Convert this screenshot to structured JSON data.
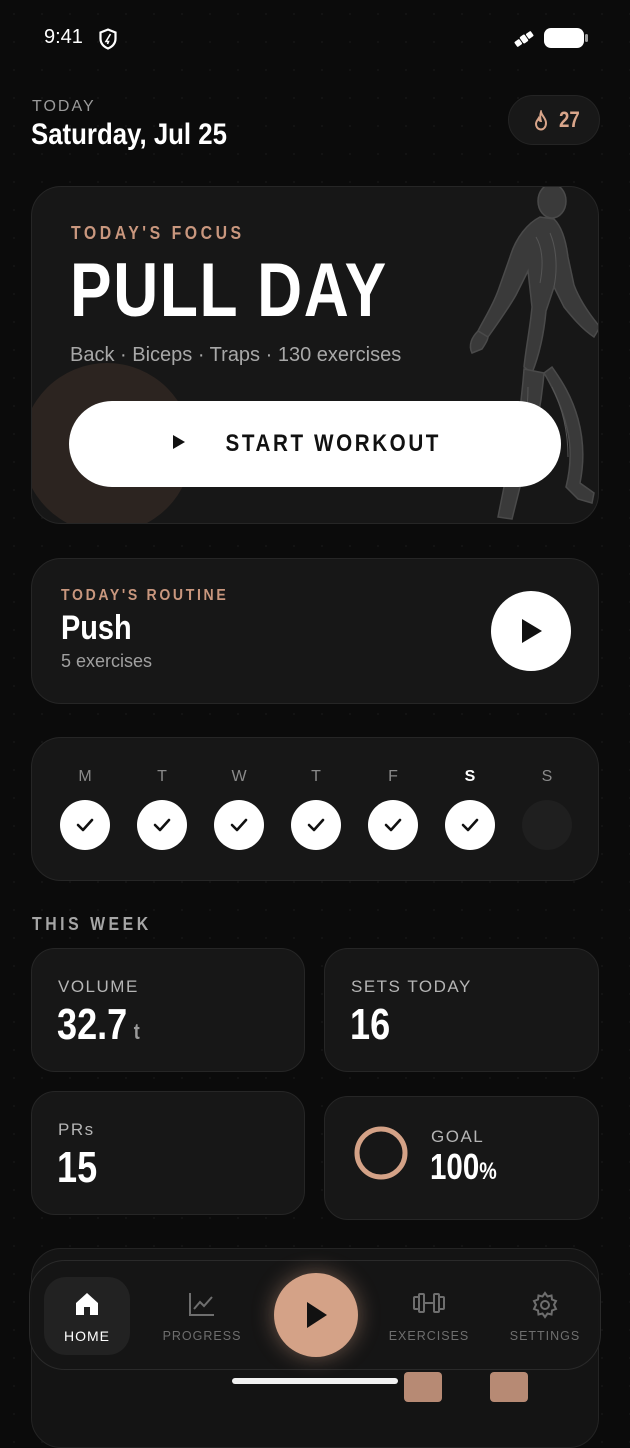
{
  "status_bar": {
    "time": "9:41"
  },
  "header": {
    "today_label": "TODAY",
    "date": "Saturday, Jul 25",
    "streak_count": "27"
  },
  "focus": {
    "label": "TODAY'S FOCUS",
    "title": "PULL DAY",
    "subtitle": "Back · Biceps · Traps · 130 exercises",
    "start_label": "START WORKOUT"
  },
  "routine": {
    "label": "TODAY'S ROUTINE",
    "name": "Push",
    "count": "5 exercises"
  },
  "week_days": [
    {
      "letter": "M",
      "done": true,
      "current": false
    },
    {
      "letter": "T",
      "done": true,
      "current": false
    },
    {
      "letter": "W",
      "done": true,
      "current": false
    },
    {
      "letter": "T",
      "done": true,
      "current": false
    },
    {
      "letter": "F",
      "done": true,
      "current": false
    },
    {
      "letter": "S",
      "done": true,
      "current": true
    },
    {
      "letter": "S",
      "done": false,
      "current": false
    }
  ],
  "this_week": {
    "heading": "THIS WEEK",
    "volume": {
      "label": "VOLUME",
      "value": "32.7",
      "unit": "t"
    },
    "sets_today": {
      "label": "SETS TODAY",
      "value": "16"
    },
    "prs": {
      "label": "PRs",
      "value": "15"
    },
    "goal": {
      "label": "GOAL",
      "value": "100",
      "unit": "%",
      "progress": 1.0
    }
  },
  "nav": {
    "home": "HOME",
    "progress": "PROGRESS",
    "exercises": "EXERCISES",
    "settings": "SETTINGS"
  },
  "colors": {
    "accent": "#d4a287",
    "label_accent": "#c9977e",
    "background": "#0b0b0b",
    "card": "#171717"
  }
}
